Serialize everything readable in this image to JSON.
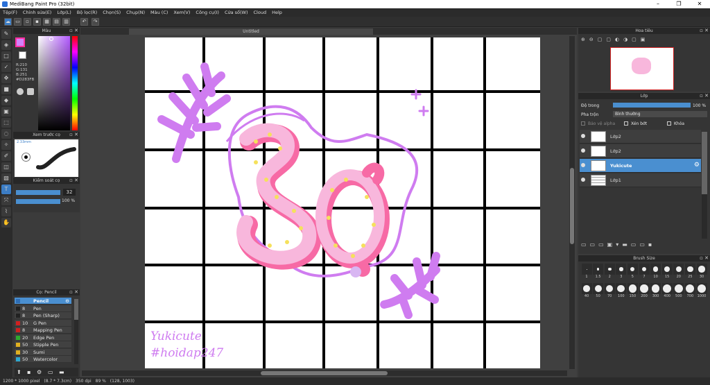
{
  "window": {
    "title": "MediBang Paint Pro (32bit)"
  },
  "menu": [
    "Tệp(F)",
    "Chỉnh sửa(E)",
    "Lớp(L)",
    "Bộ lọc(R)",
    "Chọn(S)",
    "Chụp(N)",
    "Màu (C)",
    "Xem(V)",
    "Công cụ(I)",
    "Cửa sổ(W)",
    "Cloud",
    "Help"
  ],
  "tab": {
    "title": "Untitled"
  },
  "color": {
    "title": "Màu",
    "r": "R:210",
    "g": "G:131",
    "b": "B:251",
    "hex": "#D283FB",
    "fg": "#d283fb"
  },
  "brush_preview": {
    "title": "Xem trước cọ",
    "size": "2.33mm"
  },
  "brush_control": {
    "title": "Kiểm soát cọ",
    "size": "32",
    "opacity": "100 %",
    "size_fraction": 0.32,
    "opacity_fraction": 1.0
  },
  "pencil_panel": {
    "title": "Cọ: Pencil",
    "brushes": [
      {
        "size": "",
        "name": "Pencil",
        "color": "#2e6db4"
      },
      {
        "size": "8",
        "name": "Pen",
        "color": "#222"
      },
      {
        "size": "8",
        "name": "Pen (Sharp)",
        "color": "#222"
      },
      {
        "size": "10",
        "name": "G Pen",
        "color": "#d02020"
      },
      {
        "size": "8",
        "name": "Mapping Pen",
        "color": "#d02020"
      },
      {
        "size": "20",
        "name": "Edge Pen",
        "color": "#2eaa2e"
      },
      {
        "size": "50",
        "name": "Stipple Pen",
        "color": "#e0b020"
      },
      {
        "size": "30",
        "name": "Sumi",
        "color": "#e0b020"
      },
      {
        "size": "50",
        "name": "Watercolor",
        "color": "#2ea8d0"
      }
    ]
  },
  "navigator": {
    "title": "Hoa tiêu"
  },
  "layers": {
    "title": "Lớp",
    "opacity_label": "Độ trong",
    "opacity": "100 %",
    "blend_label": "Pha trộn",
    "blend": "Bình thường",
    "protect_alpha": "Bảo vệ alpha",
    "clip": "Xén bớt",
    "lock": "Khóa",
    "items": [
      {
        "name": "Lớp2",
        "selected": false
      },
      {
        "name": "Lớp2",
        "selected": false
      },
      {
        "name": "Yukicute",
        "selected": true
      },
      {
        "name": "Lớp1",
        "selected": false
      }
    ]
  },
  "brush_size": {
    "title": "Brush Size",
    "sizes": [
      "1",
      "1.5",
      "2",
      "3",
      "5",
      "7",
      "10",
      "15",
      "20",
      "25",
      "30",
      "40",
      "50",
      "70",
      "100",
      "150",
      "200",
      "300",
      "400",
      "500",
      "700",
      "1000"
    ]
  },
  "canvas": {
    "signature1": "Yukicute",
    "signature2": "#hoidap247",
    "bg": "#ffffff"
  },
  "status": {
    "dims": "1200 * 1000 pixel",
    "cm": "(8.7 * 7.3cm)",
    "dpi": "350 dpi",
    "zoom": "89 %",
    "coord": "(128, 1003)"
  }
}
